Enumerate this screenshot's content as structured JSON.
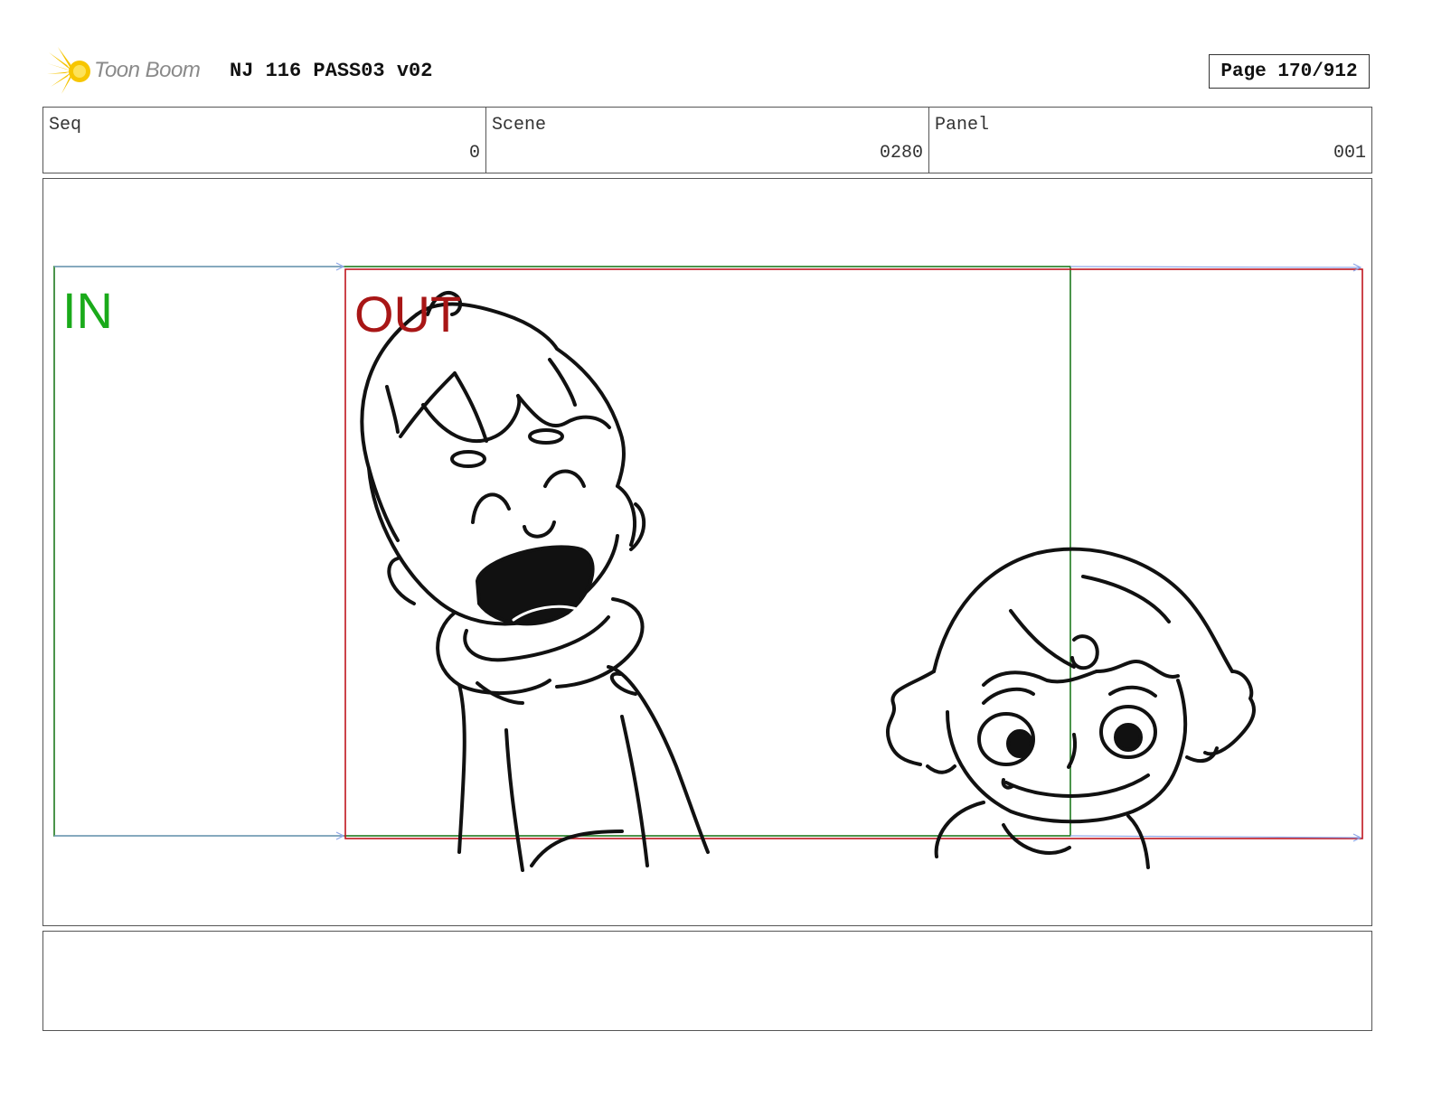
{
  "header": {
    "logo_text": "Toon Boom",
    "doc_title": "NJ 116 PASS03 v02",
    "page_counter": "Page 170/912"
  },
  "info": {
    "seq_label": "Seq",
    "seq_value": "0",
    "scene_label": "Scene",
    "scene_value": "0280",
    "panel_label": "Panel",
    "panel_value": "001"
  },
  "frame": {
    "in_label": "IN",
    "out_label": "OUT"
  },
  "colors": {
    "in_frame": "#1e7a1e",
    "out_frame": "#c0161e",
    "logo_star": "#f5c400",
    "ink": "#111111"
  },
  "notes": {}
}
